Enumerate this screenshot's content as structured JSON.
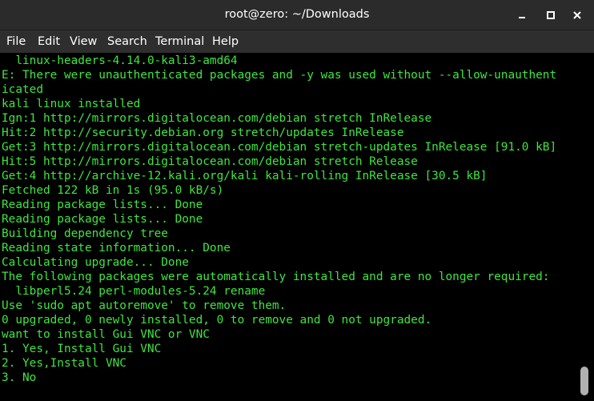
{
  "window": {
    "title": "root@zero: ~/Downloads"
  },
  "menu": [
    "File",
    "Edit",
    "View",
    "Search",
    "Terminal",
    "Help"
  ],
  "terminal": {
    "lines": [
      "  linux-headers-4.14.0-kali3-amd64",
      "E: There were unauthenticated packages and -y was used without --allow-unauthent",
      "icated",
      "kali linux installed",
      "Ign:1 http://mirrors.digitalocean.com/debian stretch InRelease",
      "Hit:2 http://security.debian.org stretch/updates InRelease",
      "Get:3 http://mirrors.digitalocean.com/debian stretch-updates InRelease [91.0 kB]",
      "Hit:5 http://mirrors.digitalocean.com/debian stretch Release",
      "Get:4 http://archive-12.kali.org/kali kali-rolling InRelease [30.5 kB]",
      "Fetched 122 kB in 1s (95.0 kB/s)",
      "Reading package lists... Done",
      "Reading package lists... Done",
      "Building dependency tree",
      "Reading state information... Done",
      "Calculating upgrade... Done",
      "The following packages were automatically installed and are no longer required:",
      "  libperl5.24 perl-modules-5.24 rename",
      "Use 'sudo apt autoremove' to remove them.",
      "0 upgraded, 0 newly installed, 0 to remove and 0 not upgraded.",
      "want to install Gui VNC or VNC",
      "1. Yes, Install Gui VNC",
      "2. Yes,Install VNC",
      "3. No"
    ],
    "text_color": "#3ee63e",
    "background": "#000000"
  }
}
